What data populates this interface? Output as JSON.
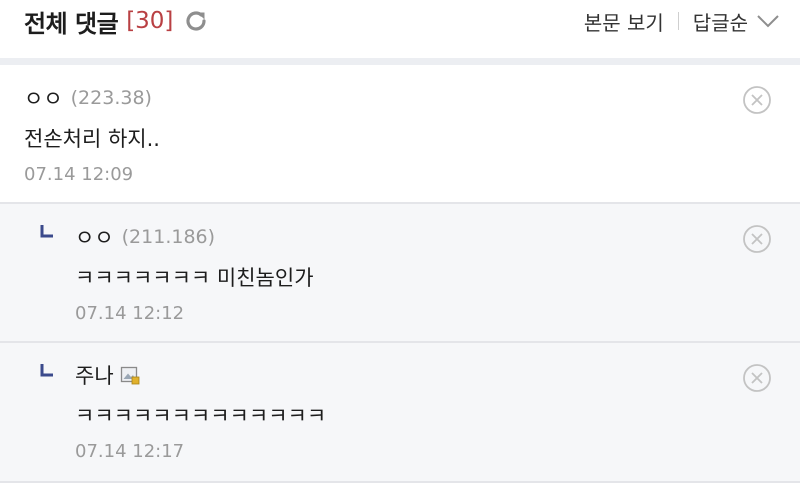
{
  "header": {
    "title": "전체 댓글",
    "count": "[30]",
    "view_post_label": "본문 보기",
    "sort_label": "답글순"
  },
  "comments": [
    {
      "author": "ㅇㅇ",
      "ip": "(223.38)",
      "text": "전손처리 하지..",
      "date": "07.14 12:09",
      "is_reply": false
    },
    {
      "author": "ㅇㅇ",
      "ip": "(211.186)",
      "text": "ㅋㅋㅋㅋㅋㅋㅋ 미친놈인가",
      "date": "07.14 12:12",
      "is_reply": true
    },
    {
      "author": "주나",
      "ip": "",
      "text": "ㅋㅋㅋㅋㅋㅋㅋㅋㅋㅋㅋㅋㅋ",
      "date": "07.14 12:17",
      "is_reply": true,
      "has_image_icon": true
    }
  ],
  "icons": {
    "refresh": "refresh-icon",
    "chevron": "chevron-down-icon",
    "delete": "close-circle-icon",
    "reply": "reply-arrow-icon",
    "image": "image-icon"
  },
  "colors": {
    "count": "#b94043",
    "reply_background": "#f6f7f9",
    "reply_mark": "#3b4a8c",
    "muted_text": "#9a9a9a"
  }
}
